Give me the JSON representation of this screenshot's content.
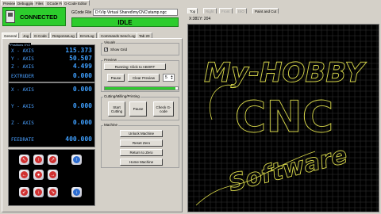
{
  "top": {
    "menu_tabs": [
      "Preview",
      "Debugging",
      "Files",
      "GCode File",
      "G-Code Editor"
    ],
    "connected_label": "CONNECTED",
    "gcode_file_label": "GCode File",
    "gcode_file_path": "D:\\Vip Virtual Shared\\myCNC\\stamp.ngc",
    "status": "IDLE"
  },
  "left_tabs": [
    "General",
    "Jog",
    "G-Code",
    "ResponseLog",
    "ErrorLog",
    "Commands Send Log",
    "Tab 20"
  ],
  "dro": {
    "title": "Positions XYZ",
    "machine": [
      {
        "axis": "X - AXIS",
        "value": "115.373"
      },
      {
        "axis": "Y - AXIS",
        "value": "50.507"
      },
      {
        "axis": "Z - AXIS",
        "value": "4.499"
      },
      {
        "axis": "EXTRUDER",
        "value": "0.000"
      }
    ],
    "work": [
      {
        "axis": "X - AXIS",
        "value": "0.000"
      },
      {
        "axis": "Y - AXIS",
        "value": "0.000"
      },
      {
        "axis": "Z - AXIS",
        "value": "0.000"
      },
      {
        "axis": "FEEDRATE",
        "value": "400.000"
      }
    ]
  },
  "visuals": {
    "title": "Visuals",
    "show_grid": "Show Grid",
    "show_grid_checked": true
  },
  "preview": {
    "title": "Preview",
    "running_label": "Running: Click to ABORT",
    "pause_label": "Pause",
    "clear_preview_label": "Clear Preview",
    "speed_value": "5",
    "progress": 0.97,
    "progress_color": "#2ec92e"
  },
  "cutting": {
    "title": "Cutting/Milling/Printing",
    "start_label": "Start Cutting",
    "pause_label": "Pause",
    "check_label": "Check G-code"
  },
  "machine": {
    "title": "Machine",
    "unlock_label": "Unlock Machine",
    "reset_label": "Reset Zero",
    "return_label": "Return to Zero",
    "home_label": "Home Machine"
  },
  "jog": {
    "buttons": [
      {
        "name": "jog-up-left-icon",
        "color": "red",
        "glyph": "↖"
      },
      {
        "name": "jog-up-icon",
        "color": "red",
        "glyph": "↑"
      },
      {
        "name": "jog-up-right-icon",
        "color": "red",
        "glyph": "↗"
      },
      {
        "name": "jog-z-up-icon",
        "color": "blue",
        "glyph": "↑"
      },
      {
        "name": "jog-left-icon",
        "color": "red",
        "glyph": "←"
      },
      {
        "name": "jog-stop-icon",
        "color": "red",
        "glyph": "●"
      },
      {
        "name": "jog-right-icon",
        "color": "red",
        "glyph": "→"
      },
      {
        "name": "jog-down-left-icon",
        "color": "red",
        "glyph": "↙"
      },
      {
        "name": "jog-down-icon",
        "color": "red",
        "glyph": "↓"
      },
      {
        "name": "jog-down-right-icon",
        "color": "red",
        "glyph": "↘"
      },
      {
        "name": "jog-z-down-icon",
        "color": "blue",
        "glyph": "↓"
      }
    ]
  },
  "view": {
    "view_tabs": [
      "Top",
      "Right",
      "Front",
      "ISO",
      "Paint and Cut"
    ],
    "coords": "X:381Y: 204",
    "text_line1": "My-HOBBY",
    "text_line2": "CNC",
    "text_line3": "Software",
    "accent_color": "#d8d84a"
  }
}
